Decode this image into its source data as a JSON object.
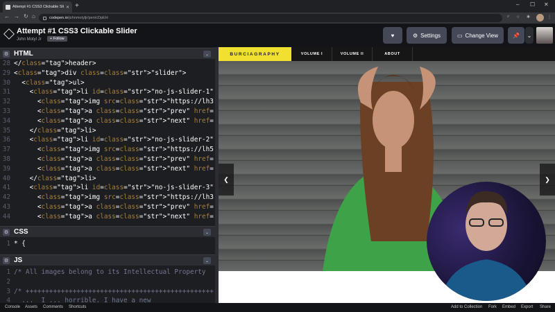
{
  "browser": {
    "tab_title": "Attempt #1 CSS3 Clickable Slider",
    "url_domain": "codepen.io",
    "url_path": "/johnmotyljr/pen/cDpEH"
  },
  "header": {
    "title": "Attempt #1 CSS3 Clickable Slider",
    "author": "John Motyl Jr",
    "follow_label": "+ Follow",
    "settings_label": "Settings",
    "change_view_label": "Change View"
  },
  "editors": {
    "html_label": "HTML",
    "css_label": "CSS",
    "js_label": "JS",
    "html_lines": [
      {
        "n": "28",
        "c": "</header>"
      },
      {
        "n": "29",
        "c": "<div class=\"slider\">"
      },
      {
        "n": "30",
        "c": "  <ul>"
      },
      {
        "n": "31",
        "c": "    <li id=\"no-js-slider-1\" class=\"slide\">"
      },
      {
        "n": "32",
        "c": "      <img src=\"https://lh3.googleusercontent.com/"
      },
      {
        "n": "33",
        "c": "      <a class=\"prev\" href=\"#no-js-slider-10\">prev</"
      },
      {
        "n": "34",
        "c": "      <a class=\"next\" href=\"#no-js-slider-2\">next</"
      },
      {
        "n": "35",
        "c": "    </li>"
      },
      {
        "n": "36",
        "c": "    <li id=\"no-js-slider-2\" class=\"slide\">"
      },
      {
        "n": "37",
        "c": "      <img src=\"https://lh5.googleusercontent.com/"
      },
      {
        "n": "38",
        "c": "      <a class=\"prev\" href=\"#no-js-slider-1\">prev</"
      },
      {
        "n": "39",
        "c": "      <a class=\"next\" href=\"#no-js-slider-3\">next</"
      },
      {
        "n": "40",
        "c": "    </li>"
      },
      {
        "n": "41",
        "c": "    <li id=\"no-js-slider-3\" class=\"slide\">"
      },
      {
        "n": "42",
        "c": "      <img src=\"https://lh3.googleusercontent.com/"
      },
      {
        "n": "43",
        "c": "      <a class=\"prev\" href=\"#no-js-slider-2\">prev</"
      },
      {
        "n": "44",
        "c": "      <a class=\"next\" href=\"#no-js-slider-4\">next</"
      }
    ],
    "css_lines": [
      {
        "n": "1",
        "c": "* {"
      }
    ],
    "js_lines": [
      {
        "n": "1",
        "c": "/* All images belong to its Intellectual Property"
      },
      {
        "n": "2",
        "c": ""
      },
      {
        "n": "3",
        "c": "/* ++++++++++++++++++++++++++++++++++++++++++++++++"
      },
      {
        "n": "4",
        "c": "  ...  I ... horrible. I have a new"
      }
    ]
  },
  "preview": {
    "brand": "BURCIAGRAPHY",
    "nav_links": [
      "VOLUME I",
      "VOLUME II",
      "ABOUT"
    ],
    "prev_arrow": "❮",
    "next_arrow": "❯"
  },
  "footer": {
    "left": [
      "Console",
      "Assets",
      "Comments",
      "Shortcuts"
    ],
    "right": [
      "Add to Collection",
      "Fork",
      "Embed",
      "Export",
      "Share"
    ]
  }
}
